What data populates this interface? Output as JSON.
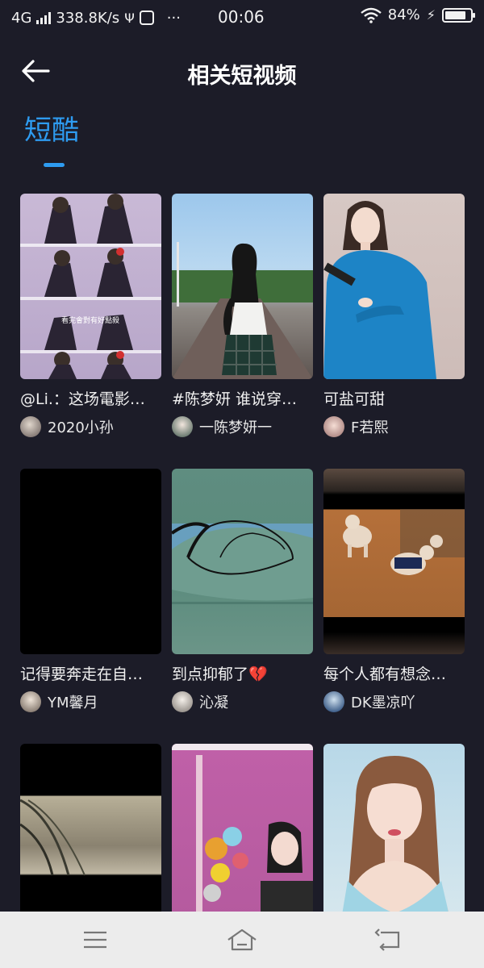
{
  "status_bar": {
    "network": "4G",
    "speed": "338.8K/s",
    "time": "00:06",
    "battery": "84%",
    "battery_level": 0.84
  },
  "header": {
    "title": "相关短视频"
  },
  "tabs": [
    {
      "label": "短酷",
      "selected": true
    }
  ],
  "videos": [
    {
      "caption": "@Li.：这场電影…",
      "author": "2020小孙"
    },
    {
      "caption": "#陈梦妍 谁说穿…",
      "author": "一陈梦妍一"
    },
    {
      "caption": "可盐可甜",
      "author": "F若熙"
    },
    {
      "caption": "记得要奔走在自…",
      "author": "YM馨月"
    },
    {
      "caption": "到点抑郁了💔",
      "author": "沁凝"
    },
    {
      "caption": "每个人都有想念…",
      "author": "DK墨凉吖"
    },
    {
      "caption": "",
      "author": ""
    },
    {
      "caption": "",
      "author": ""
    },
    {
      "caption": "",
      "author": ""
    }
  ],
  "thumb_text": {
    "v1_overlay": "看完會對有好點殺"
  },
  "colors": {
    "background": "#1c1c28",
    "accent": "#2e9bf0",
    "nav_bar": "#ececec"
  },
  "icons": {
    "back": "arrow-left-icon",
    "menu": "menu-icon",
    "home": "home-icon",
    "return": "return-icon"
  }
}
